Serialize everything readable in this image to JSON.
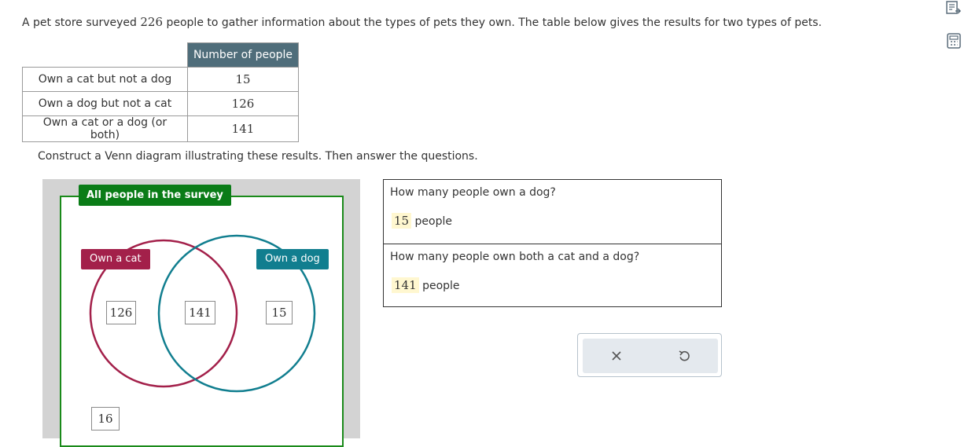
{
  "intro": {
    "before": "A pet store surveyed ",
    "total": "226",
    "after": " people to gather information about the types of pets they own. The table below gives the results for two types of pets."
  },
  "table": {
    "column_header": "Number of people",
    "rows": [
      {
        "label": "Own a cat but not a dog",
        "value": "15"
      },
      {
        "label": "Own a dog but not a cat",
        "value": "126"
      },
      {
        "label": "Own a cat or a dog (or both)",
        "value": "141"
      }
    ]
  },
  "instruction": "Construct a Venn diagram illustrating these results. Then answer the questions.",
  "venn": {
    "universe_label": "All people in the survey",
    "set_a_label": "Own a cat",
    "set_b_label": "Own a dog",
    "only_a": "126",
    "both": "141",
    "only_b": "15",
    "outside": "16",
    "colors": {
      "set_a": "#a3204a",
      "set_b": "#117e8f",
      "universe": "#0a7c17"
    }
  },
  "questions": [
    {
      "text": "How many people own a dog?",
      "answer": "15",
      "unit": "people"
    },
    {
      "text": "How many people own both a cat and a dog?",
      "answer": "141",
      "unit": "people"
    }
  ],
  "actions": {
    "clear_icon": "x-icon",
    "undo_icon": "undo-icon"
  },
  "side_tools": {
    "explanation_icon": "explanation-icon",
    "calculator_icon": "calculator-icon"
  }
}
